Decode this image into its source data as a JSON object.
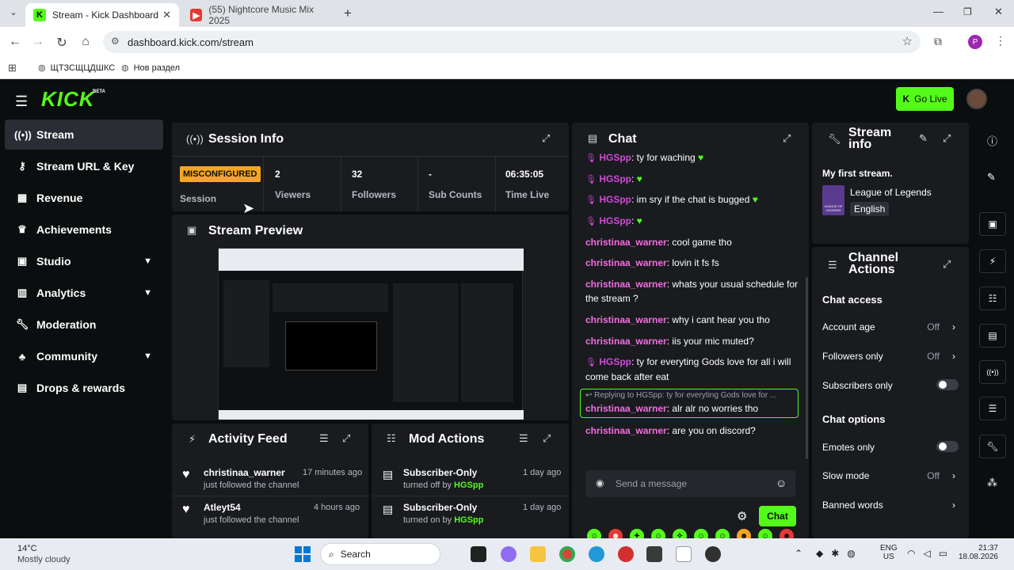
{
  "browser": {
    "tabs": [
      {
        "title": "Stream - Kick Dashboard",
        "active": true
      },
      {
        "title": "(55) Nightcore Music Mix 2025",
        "active": false
      }
    ],
    "url": "dashboard.kick.com/stream",
    "bookmarks": [
      "ЩТЗСЩЦДШКС",
      "Нов раздел"
    ],
    "profile_initial": "P"
  },
  "header": {
    "logo": "KICK",
    "beta": "BETA",
    "go_live": "Go Live"
  },
  "sidebar": {
    "items": [
      {
        "label": "Stream",
        "icon": "broadcast-icon",
        "active": true
      },
      {
        "label": "Stream URL & Key",
        "icon": "key-icon"
      },
      {
        "label": "Revenue",
        "icon": "revenue-icon"
      },
      {
        "label": "Achievements",
        "icon": "trophy-icon"
      },
      {
        "label": "Studio",
        "icon": "studio-icon",
        "expandable": true
      },
      {
        "label": "Analytics",
        "icon": "analytics-icon",
        "expandable": true
      },
      {
        "label": "Moderation",
        "icon": "wrench-icon"
      },
      {
        "label": "Community",
        "icon": "community-icon",
        "expandable": true
      },
      {
        "label": "Drops & rewards",
        "icon": "gift-icon"
      }
    ]
  },
  "session": {
    "title": "Session Info",
    "badge": "MISCONFIGURED",
    "badge_label": "Session",
    "stats": [
      {
        "value": "2",
        "label": "Viewers"
      },
      {
        "value": "32",
        "label": "Followers"
      },
      {
        "value": "-",
        "label": "Sub Counts"
      },
      {
        "value": "06:35:05",
        "label": "Time Live"
      }
    ]
  },
  "preview": {
    "title": "Stream Preview"
  },
  "activity": {
    "title": "Activity Feed",
    "items": [
      {
        "user": "christinaa_warner",
        "action": "just followed the channel",
        "time": "17 minutes ago"
      },
      {
        "user": "Atleyt54",
        "action": "just followed the channel",
        "time": "4 hours ago"
      }
    ]
  },
  "mod_actions": {
    "title": "Mod Actions",
    "items": [
      {
        "title": "Subscriber-Only",
        "action": "turned off by",
        "by": "HGSpp",
        "time": "1 day ago"
      },
      {
        "title": "Subscriber-Only",
        "action": "turned on by",
        "by": "HGSpp",
        "time": "1 day ago"
      }
    ]
  },
  "chat": {
    "title": "Chat",
    "messages": [
      {
        "user": "HGSpp",
        "text": "ty for waching",
        "mod": true,
        "heart": true
      },
      {
        "user": "HGSpp",
        "text": "",
        "mod": true,
        "heart": true
      },
      {
        "user": "HGSpp",
        "text": "im sry if the chat is bugged",
        "mod": true,
        "heart": true
      },
      {
        "user": "HGSpp",
        "text": "",
        "mod": true,
        "heart": true
      },
      {
        "user": "christinaa_warner",
        "text": "cool game tho"
      },
      {
        "user": "christinaa_warner",
        "text": "lovin it fs fs"
      },
      {
        "user": "christinaa_warner",
        "text": "whats your usual schedule for the stream ?"
      },
      {
        "user": "christinaa_warner",
        "text": "why i cant hear you tho"
      },
      {
        "user": "christinaa_warner",
        "text": "iis your mic muted?"
      },
      {
        "user": "HGSpp",
        "text": "ty for everyting Gods love for all i will come back after eat",
        "mod": true
      }
    ],
    "reply": {
      "context": "Replying to HGSpp: ty for everyting Gods love for ...",
      "user": "christinaa_warner",
      "text": "alr alr no worries tho"
    },
    "last": {
      "user": "christinaa_warner",
      "text": "are you on discord?"
    },
    "input_placeholder": "Send a message",
    "send_label": "Chat"
  },
  "stream_info": {
    "title": "Stream info",
    "stream_title": "My first stream.",
    "category": "League of Legends",
    "language": "English",
    "thumb_text": "LEAGUE OF LEGENDS"
  },
  "channel_actions": {
    "title": "Channel Actions",
    "chat_access": "Chat access",
    "access_rows": [
      {
        "label": "Account age",
        "value": "Off"
      },
      {
        "label": "Followers only",
        "value": "Off"
      },
      {
        "label": "Subscribers only",
        "toggle": true
      }
    ],
    "chat_options": "Chat options",
    "option_rows": [
      {
        "label": "Emotes only",
        "toggle": true
      },
      {
        "label": "Slow mode",
        "value": "Off"
      },
      {
        "label": "Banned words"
      }
    ]
  },
  "taskbar": {
    "weather_temp": "14°C",
    "weather_desc": "Mostly cloudy",
    "search": "Search",
    "lang": "ENG",
    "region": "US",
    "time": "21:37",
    "date": "18.08.2026"
  },
  "colors": {
    "accent": "#53fc18",
    "misconfigured": "#f5a524",
    "mod": "#53fc18",
    "user": "#f56ce0"
  }
}
